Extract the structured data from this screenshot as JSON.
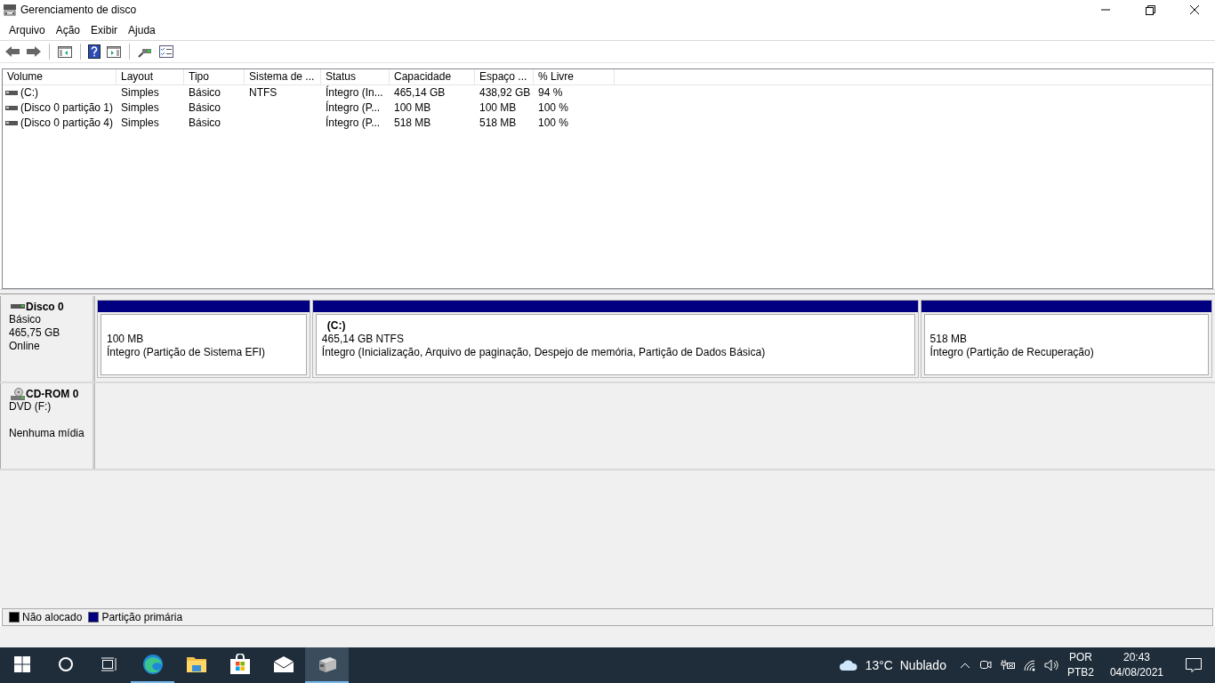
{
  "window": {
    "title": "Gerenciamento de disco"
  },
  "menu": [
    "Arquivo",
    "Ação",
    "Exibir",
    "Ajuda"
  ],
  "toolbar": [
    {
      "kind": "back"
    },
    {
      "kind": "forward"
    },
    {
      "kind": "sep"
    },
    {
      "kind": "panel"
    },
    {
      "kind": "sep"
    },
    {
      "kind": "help"
    },
    {
      "kind": "panel2"
    },
    {
      "kind": "sep"
    },
    {
      "kind": "connect"
    },
    {
      "kind": "checklist"
    }
  ],
  "table": {
    "columns": [
      "Volume",
      "Layout",
      "Tipo",
      "Sistema de ...",
      "Status",
      "Capacidade",
      "Espaço ...",
      "% Livre"
    ],
    "rows": [
      {
        "cells": [
          " (C:)",
          "Simples",
          "Básico",
          "NTFS",
          "Íntegro (In...",
          "465,14 GB",
          "438,92 GB",
          "94 %"
        ]
      },
      {
        "cells": [
          "(Disco 0 partição 1)",
          "Simples",
          "Básico",
          "",
          "Íntegro (P...",
          "100 MB",
          "100 MB",
          "100 %"
        ]
      },
      {
        "cells": [
          "(Disco 0 partição 4)",
          "Simples",
          "Básico",
          "",
          "Íntegro (P...",
          "518 MB",
          "518 MB",
          "100 %"
        ]
      }
    ]
  },
  "disks": [
    {
      "kind": "disk",
      "name": "Disco 0",
      "lines": [
        "Básico",
        "465,75 GB",
        "Online"
      ],
      "partitions": [
        {
          "size": "100 MB",
          "status": "Íntegro (Partição de Sistema EFI)",
          "color": "#000080"
        },
        {
          "title": "(C:)",
          "size": "465,14 GB NTFS",
          "status": "Íntegro (Inicialização, Arquivo de paginação, Despejo de memória, Partição de Dados Básica)",
          "color": "#000080"
        },
        {
          "size": "518 MB",
          "status": "Íntegro (Partição de Recuperação)",
          "color": "#000080"
        }
      ]
    },
    {
      "kind": "cdrom",
      "name": "CD-ROM 0",
      "lines": [
        "DVD (F:)",
        "Nenhuma mídia"
      ]
    }
  ],
  "legend": [
    {
      "label": "Não alocado",
      "color": "#000000"
    },
    {
      "label": "Partição primária",
      "color": "#000080"
    }
  ],
  "taskbar": {
    "apps": [
      {
        "kind": "start",
        "selected": false,
        "running": false
      },
      {
        "kind": "search",
        "selected": false,
        "running": false
      },
      {
        "kind": "taskview",
        "selected": false,
        "running": false
      },
      {
        "kind": "edge",
        "selected": false,
        "running": true
      },
      {
        "kind": "explorer",
        "selected": false,
        "running": false
      },
      {
        "kind": "store",
        "selected": false,
        "running": false
      },
      {
        "kind": "mail",
        "selected": false,
        "running": false
      },
      {
        "kind": "diskmgmt",
        "selected": true,
        "running": true
      }
    ],
    "weather": "13°C  Nublado",
    "language": "POR",
    "layout": "PTB2",
    "time": "20:43",
    "date": "04/08/2021"
  }
}
